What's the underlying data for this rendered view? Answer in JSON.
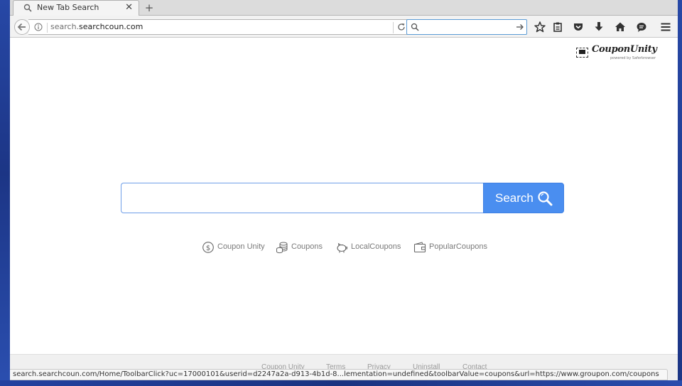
{
  "browser": {
    "tab": {
      "title": "New Tab Search",
      "close_glyph": "✕",
      "icon": "search-icon"
    },
    "new_tab_glyph": "+",
    "url": {
      "prefix": "search.",
      "domain": "searchcoun.com"
    },
    "search_bar": {
      "value": ""
    },
    "toolbar_icons": [
      "star-icon",
      "reading-list-icon",
      "pocket-icon",
      "download-icon",
      "home-icon",
      "chat-icon",
      "menu-icon"
    ]
  },
  "page": {
    "brand": {
      "name": "CouponUnity",
      "tagline": "powered by Saferbrowser"
    },
    "search": {
      "value": "",
      "button_label": "Search"
    },
    "quick_links": [
      {
        "label": "Coupon Unity",
        "icon": "dollar-circle-icon"
      },
      {
        "label": "Coupons",
        "icon": "coins-stack-icon"
      },
      {
        "label": "LocalCoupons",
        "icon": "piggy-bank-icon"
      },
      {
        "label": "PopularCoupons",
        "icon": "wallet-icon"
      }
    ],
    "footer_links": [
      "Coupon Unity",
      "Terms",
      "Privacy",
      "Uninstall",
      "Contact"
    ]
  },
  "status_bar": {
    "text": "search.searchcoun.com/Home/ToolbarClick?uc=17000101&userid=d2247a2a-d913-4b1d-8...lementation=undefined&toolbarValue=coupons&url=https://www.groupon.com/coupons"
  },
  "colors": {
    "accent": "#4a8ef0",
    "input_border": "#6f9ee8",
    "desktop": "#1e3a8c"
  }
}
